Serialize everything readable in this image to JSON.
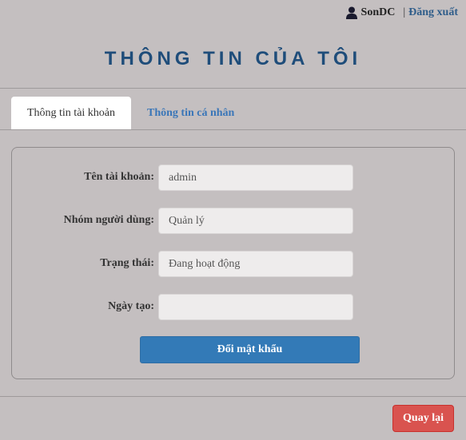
{
  "header": {
    "user_icon": "user-icon",
    "username": "SonDC",
    "separator": "|",
    "logout_label": "Đăng xuất"
  },
  "page": {
    "title": "THÔNG TIN CỦA TÔI"
  },
  "tabs": [
    {
      "label": "Thông tin tài khoản",
      "active": true
    },
    {
      "label": "Thông tin cá nhân",
      "active": false
    }
  ],
  "form": {
    "fields": [
      {
        "label": "Tên tài khoản:",
        "value": "admin"
      },
      {
        "label": "Nhóm người dùng:",
        "value": "Quản lý"
      },
      {
        "label": "Trạng thái:",
        "value": "Đang hoạt động"
      },
      {
        "label": "Ngày tạo:",
        "value": ""
      }
    ],
    "change_password_label": "Đổi mật khẩu"
  },
  "footer": {
    "back_label": "Quay lại"
  },
  "colors": {
    "background": "#c4bfc0",
    "title": "#1f4d7a",
    "primary": "#337ab7",
    "danger": "#d9534f",
    "link": "#3a76b8"
  }
}
